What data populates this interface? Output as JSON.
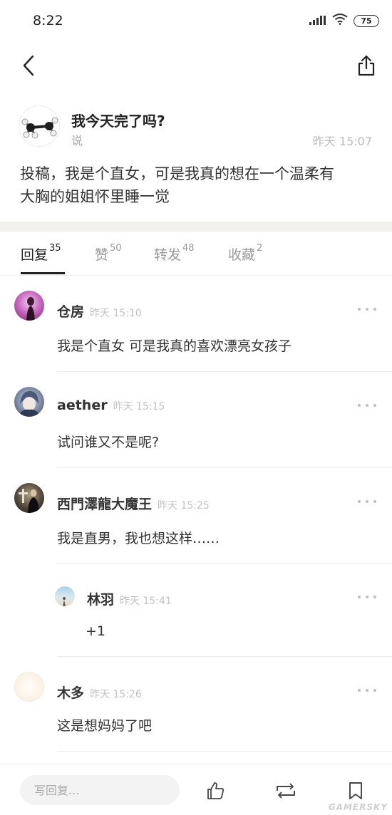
{
  "status": {
    "time": "8:22",
    "battery": "75"
  },
  "post": {
    "title": "我今天完了吗?",
    "subtitle": "说",
    "time": "昨天 15:07",
    "body_lines": [
      "投稿，我是个直女，可是我真的想在一个温柔有",
      "大胸的姐姐怀里睡一觉"
    ]
  },
  "tabs": [
    {
      "label": "回复",
      "count": "35"
    },
    {
      "label": "赞",
      "count": "50"
    },
    {
      "label": "转发",
      "count": "48"
    },
    {
      "label": "收藏",
      "count": "2"
    }
  ],
  "comments": [
    {
      "name": "仓房",
      "time": "昨天 15:10",
      "text": "我是个直女 可是我真的喜欢漂亮女孩子"
    },
    {
      "name": "aether",
      "time": "昨天 15:15",
      "text": "试问谁又不是呢?"
    },
    {
      "name": "西門澤龍大魔王",
      "time": "昨天 15:25",
      "text": "我是直男，我也想这样……"
    },
    {
      "name": "林羽",
      "time": "昨天 15:41",
      "text": "+1"
    },
    {
      "name": "木多",
      "time": "昨天 15:26",
      "text": "这是想妈妈了吧"
    }
  ],
  "bottom": {
    "reply_placeholder": "写回复..."
  },
  "watermark": "GAMERSKY",
  "icons": [
    "back-icon",
    "share-icon",
    "signal-icon",
    "wifi-icon",
    "more-icon",
    "like-icon",
    "repost-icon",
    "bookmark-icon"
  ],
  "colors": {
    "divider": "#f2f1ec",
    "muted": "#bbbbbb",
    "text": "#333333"
  }
}
